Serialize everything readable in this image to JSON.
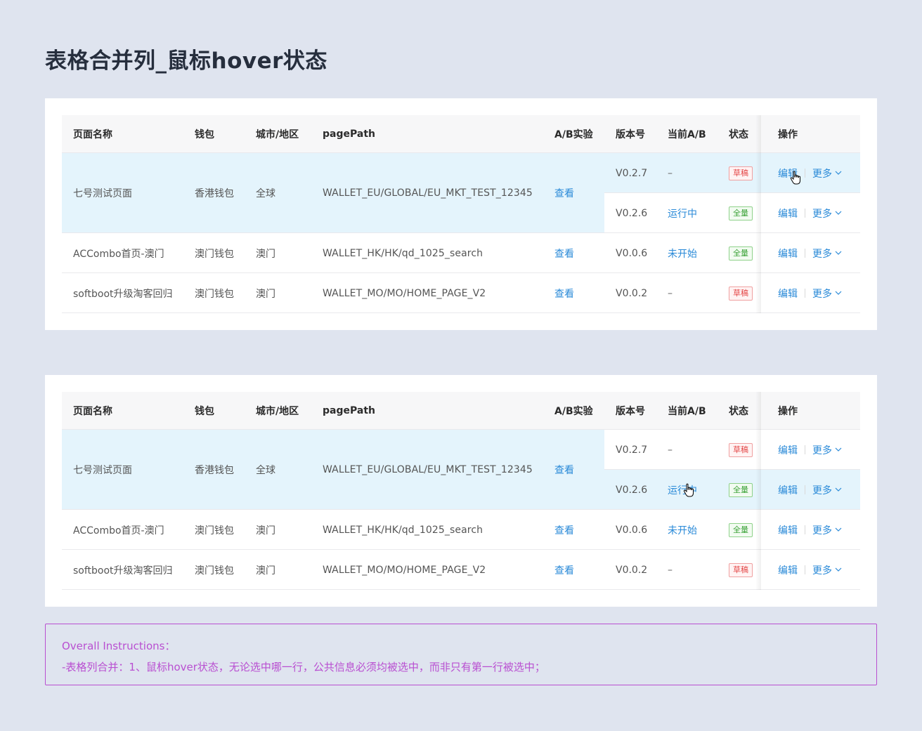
{
  "title": "表格合并列_鼠标hover状态",
  "columns": [
    "页面名称",
    "钱包",
    "城市/地区",
    "pagePath",
    "A/B实验",
    "版本号",
    "当前A/B",
    "状态",
    "操作"
  ],
  "rows": [
    {
      "name": "七号测试页面",
      "wallet": "香港钱包",
      "city": "全球",
      "path": "WALLET_EU/GLOBAL/EU_MKT_TEST_12345",
      "ab": "查看",
      "versions": [
        {
          "version": "V0.2.7",
          "current": "–",
          "status": "草稿",
          "edit": "编辑",
          "more": "更多"
        },
        {
          "version": "V0.2.6",
          "current": "运行中",
          "status": "全量",
          "edit": "编辑",
          "more": "更多"
        }
      ]
    },
    {
      "name": "ACCombo首页-澳门",
      "wallet": "澳门钱包",
      "city": "澳门",
      "path": "WALLET_HK/HK/qd_1025_search",
      "ab": "查看",
      "versions": [
        {
          "version": "V0.0.6",
          "current": "未开始",
          "status": "全量",
          "edit": "编辑",
          "more": "更多"
        }
      ]
    },
    {
      "name": "softboot升级淘客回归",
      "wallet": "澳门钱包",
      "city": "澳门",
      "path": "WALLET_MO/MO/HOME_PAGE_V2",
      "ab": "查看",
      "versions": [
        {
          "version": "V0.0.2",
          "current": "–",
          "status": "草稿",
          "edit": "编辑",
          "more": "更多"
        }
      ]
    }
  ],
  "note": {
    "title": "Overall Instructions：",
    "text": "-表格列合并：1、鼠标hover状态，无论选中哪一行，公共信息必须均被选中，而非只有第一行被选中；"
  },
  "colors": {
    "background": "#dfe4ef",
    "hover_row": "#e4f4fc",
    "link": "#2a8ad8",
    "draft_tag": "#e44a4a",
    "full_tag": "#3aa236",
    "note": "#b94fd1"
  }
}
